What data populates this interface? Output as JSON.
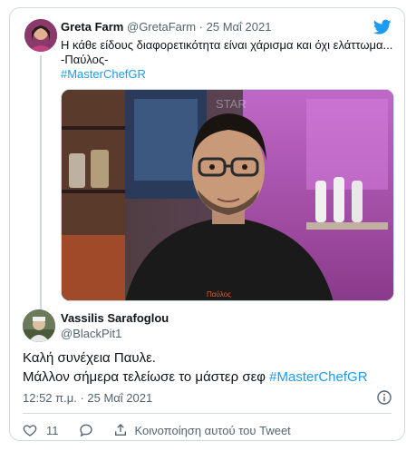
{
  "parent_tweet": {
    "name": "Greta Farm",
    "handle": "@GretaFarm",
    "separator": "·",
    "date": "25 Μαΐ 2021",
    "text_line1": "Η κάθε είδους διαφορετικότητα είναι χάρισμα και όχι ελάττωμα...",
    "text_line2": "-Παύλος-",
    "hashtag": "#MasterChefGR",
    "media_caption": "Παύλος",
    "media_overlay": "STAR"
  },
  "reply_tweet": {
    "name": "Vassilis Sarafoglou",
    "handle": "@BlackPit1",
    "text_line1": "Καλή συνέχεια Παυλε.",
    "text_line2_prefix": "Μάλλον σήμερα τελείωσε το μάστερ σεφ ",
    "text_line2_hashtag": "#MasterChefGR",
    "timestamp": "12:52 π.μ. · 25 Μαΐ 2021"
  },
  "actions": {
    "like_count": "11",
    "share_label": "Κοινοποίηση αυτού του Tweet"
  },
  "icons": {
    "brand": "twitter-bird-icon",
    "like": "heart-icon",
    "reply": "speech-bubble-icon",
    "share": "share-upload-icon",
    "info": "info-circle-icon"
  },
  "colors": {
    "accent": "#1d9bf0",
    "text": "#0f1419",
    "muted": "#536471",
    "border": "#cfd9de"
  }
}
